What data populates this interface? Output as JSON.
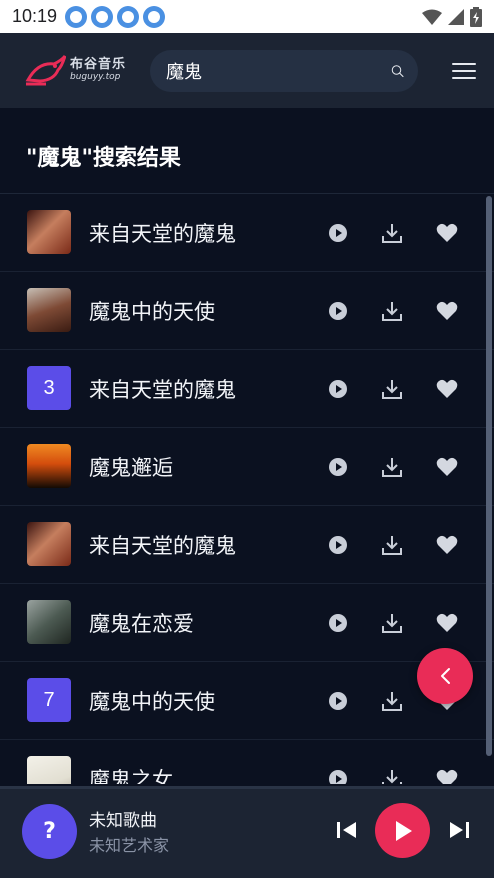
{
  "status_bar": {
    "time": "10:19"
  },
  "header": {
    "logo": {
      "name": "布谷音乐",
      "url": "buguyy.top"
    },
    "search": {
      "value": "魔鬼"
    }
  },
  "results": {
    "title": "\"魔鬼\"搜索结果"
  },
  "songs": [
    {
      "title": "来自天堂的魔鬼",
      "cover": ""
    },
    {
      "title": "魔鬼中的天使",
      "cover": ""
    },
    {
      "title": "来自天堂的魔鬼",
      "cover": "3"
    },
    {
      "title": "魔鬼邂逅",
      "cover": ""
    },
    {
      "title": "来自天堂的魔鬼",
      "cover": ""
    },
    {
      "title": "魔鬼在恋爱",
      "cover": ""
    },
    {
      "title": "魔鬼中的天使",
      "cover": "7"
    },
    {
      "title": "魔鬼之女",
      "cover": ""
    }
  ],
  "player": {
    "cover_glyph": "?",
    "title": "未知歌曲",
    "artist": "未知艺术家"
  },
  "colors": {
    "accent": "#e92c57",
    "placeholder_cover": "#5b4de8",
    "background": "#0b1120",
    "header": "#1c2433"
  },
  "icons": {
    "row_actions": [
      "play-circle-icon",
      "download-icon",
      "heart-icon"
    ],
    "player_controls": [
      "skip-previous-icon",
      "play-icon",
      "skip-next-icon"
    ]
  }
}
